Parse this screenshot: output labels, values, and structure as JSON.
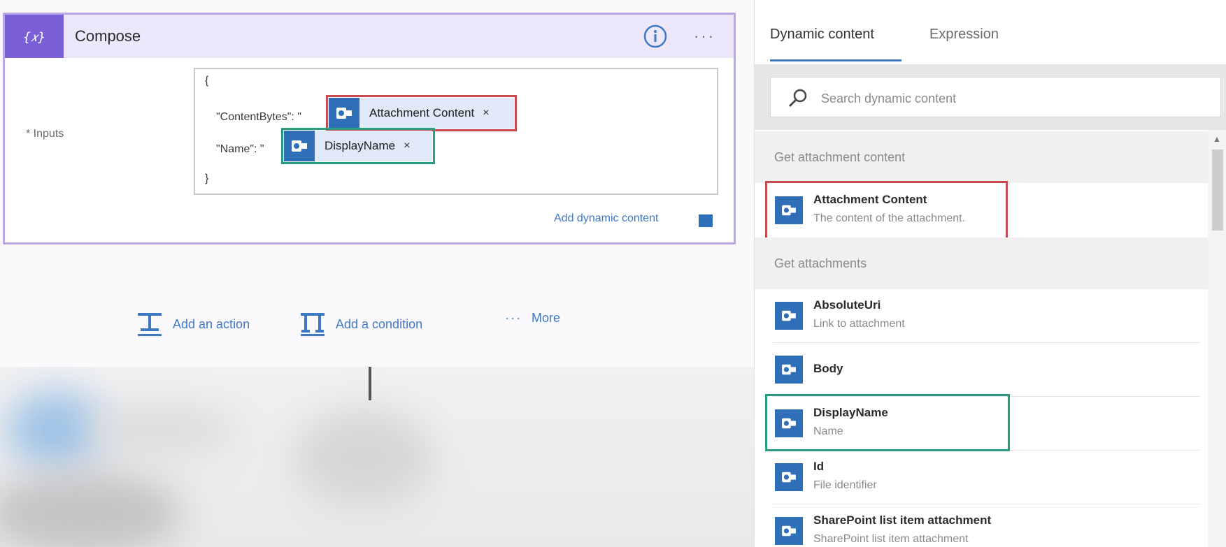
{
  "compose": {
    "title": "Compose",
    "inputs_label": "* Inputs",
    "code": {
      "open_brace": "{",
      "content_bytes_key": "\"ContentBytes\": \"",
      "name_key": "\"Name\": \"",
      "close_quote_1": "\"",
      "close_quote_2": "\"",
      "close_brace": "}"
    },
    "tokens": {
      "attachment_content": "Attachment Content",
      "display_name": "DisplayName",
      "remove_symbol": "×"
    },
    "add_dynamic_content": "Add dynamic content"
  },
  "actions": {
    "add_action": "Add an action",
    "add_condition": "Add a condition",
    "more": "More",
    "more_dots": "···"
  },
  "panel": {
    "tabs": [
      "Dynamic content",
      "Expression"
    ],
    "active_tab": "Dynamic content",
    "search_placeholder": "Search dynamic content",
    "sections": [
      {
        "header": "Get attachment content",
        "items": [
          {
            "title": "Attachment Content",
            "description": "The content of the attachment."
          }
        ]
      },
      {
        "header": "Get attachments",
        "items": [
          {
            "title": "AbsoluteUri",
            "description": "Link to attachment"
          },
          {
            "title": "Body",
            "description": ""
          },
          {
            "title": "DisplayName",
            "description": "Name"
          },
          {
            "title": "Id",
            "description": "File identifier"
          },
          {
            "title": "SharePoint list item attachment",
            "description": "SharePoint list item attachment"
          }
        ]
      }
    ]
  },
  "icons": {
    "compose": "variable-braces-icon",
    "info": "info-circle-icon",
    "dynamic_token": "outlook-icon",
    "search": "search-icon",
    "add_action": "add-action-icon",
    "add_condition": "add-condition-icon"
  },
  "colors": {
    "compose_accent": "#7b5fd6",
    "compose_header_bg": "#ece7fb",
    "token_icon": "#2e6fb7",
    "link": "#3f79c2",
    "highlight_red": "#c94a4f",
    "highlight_green": "#2a9d80"
  }
}
